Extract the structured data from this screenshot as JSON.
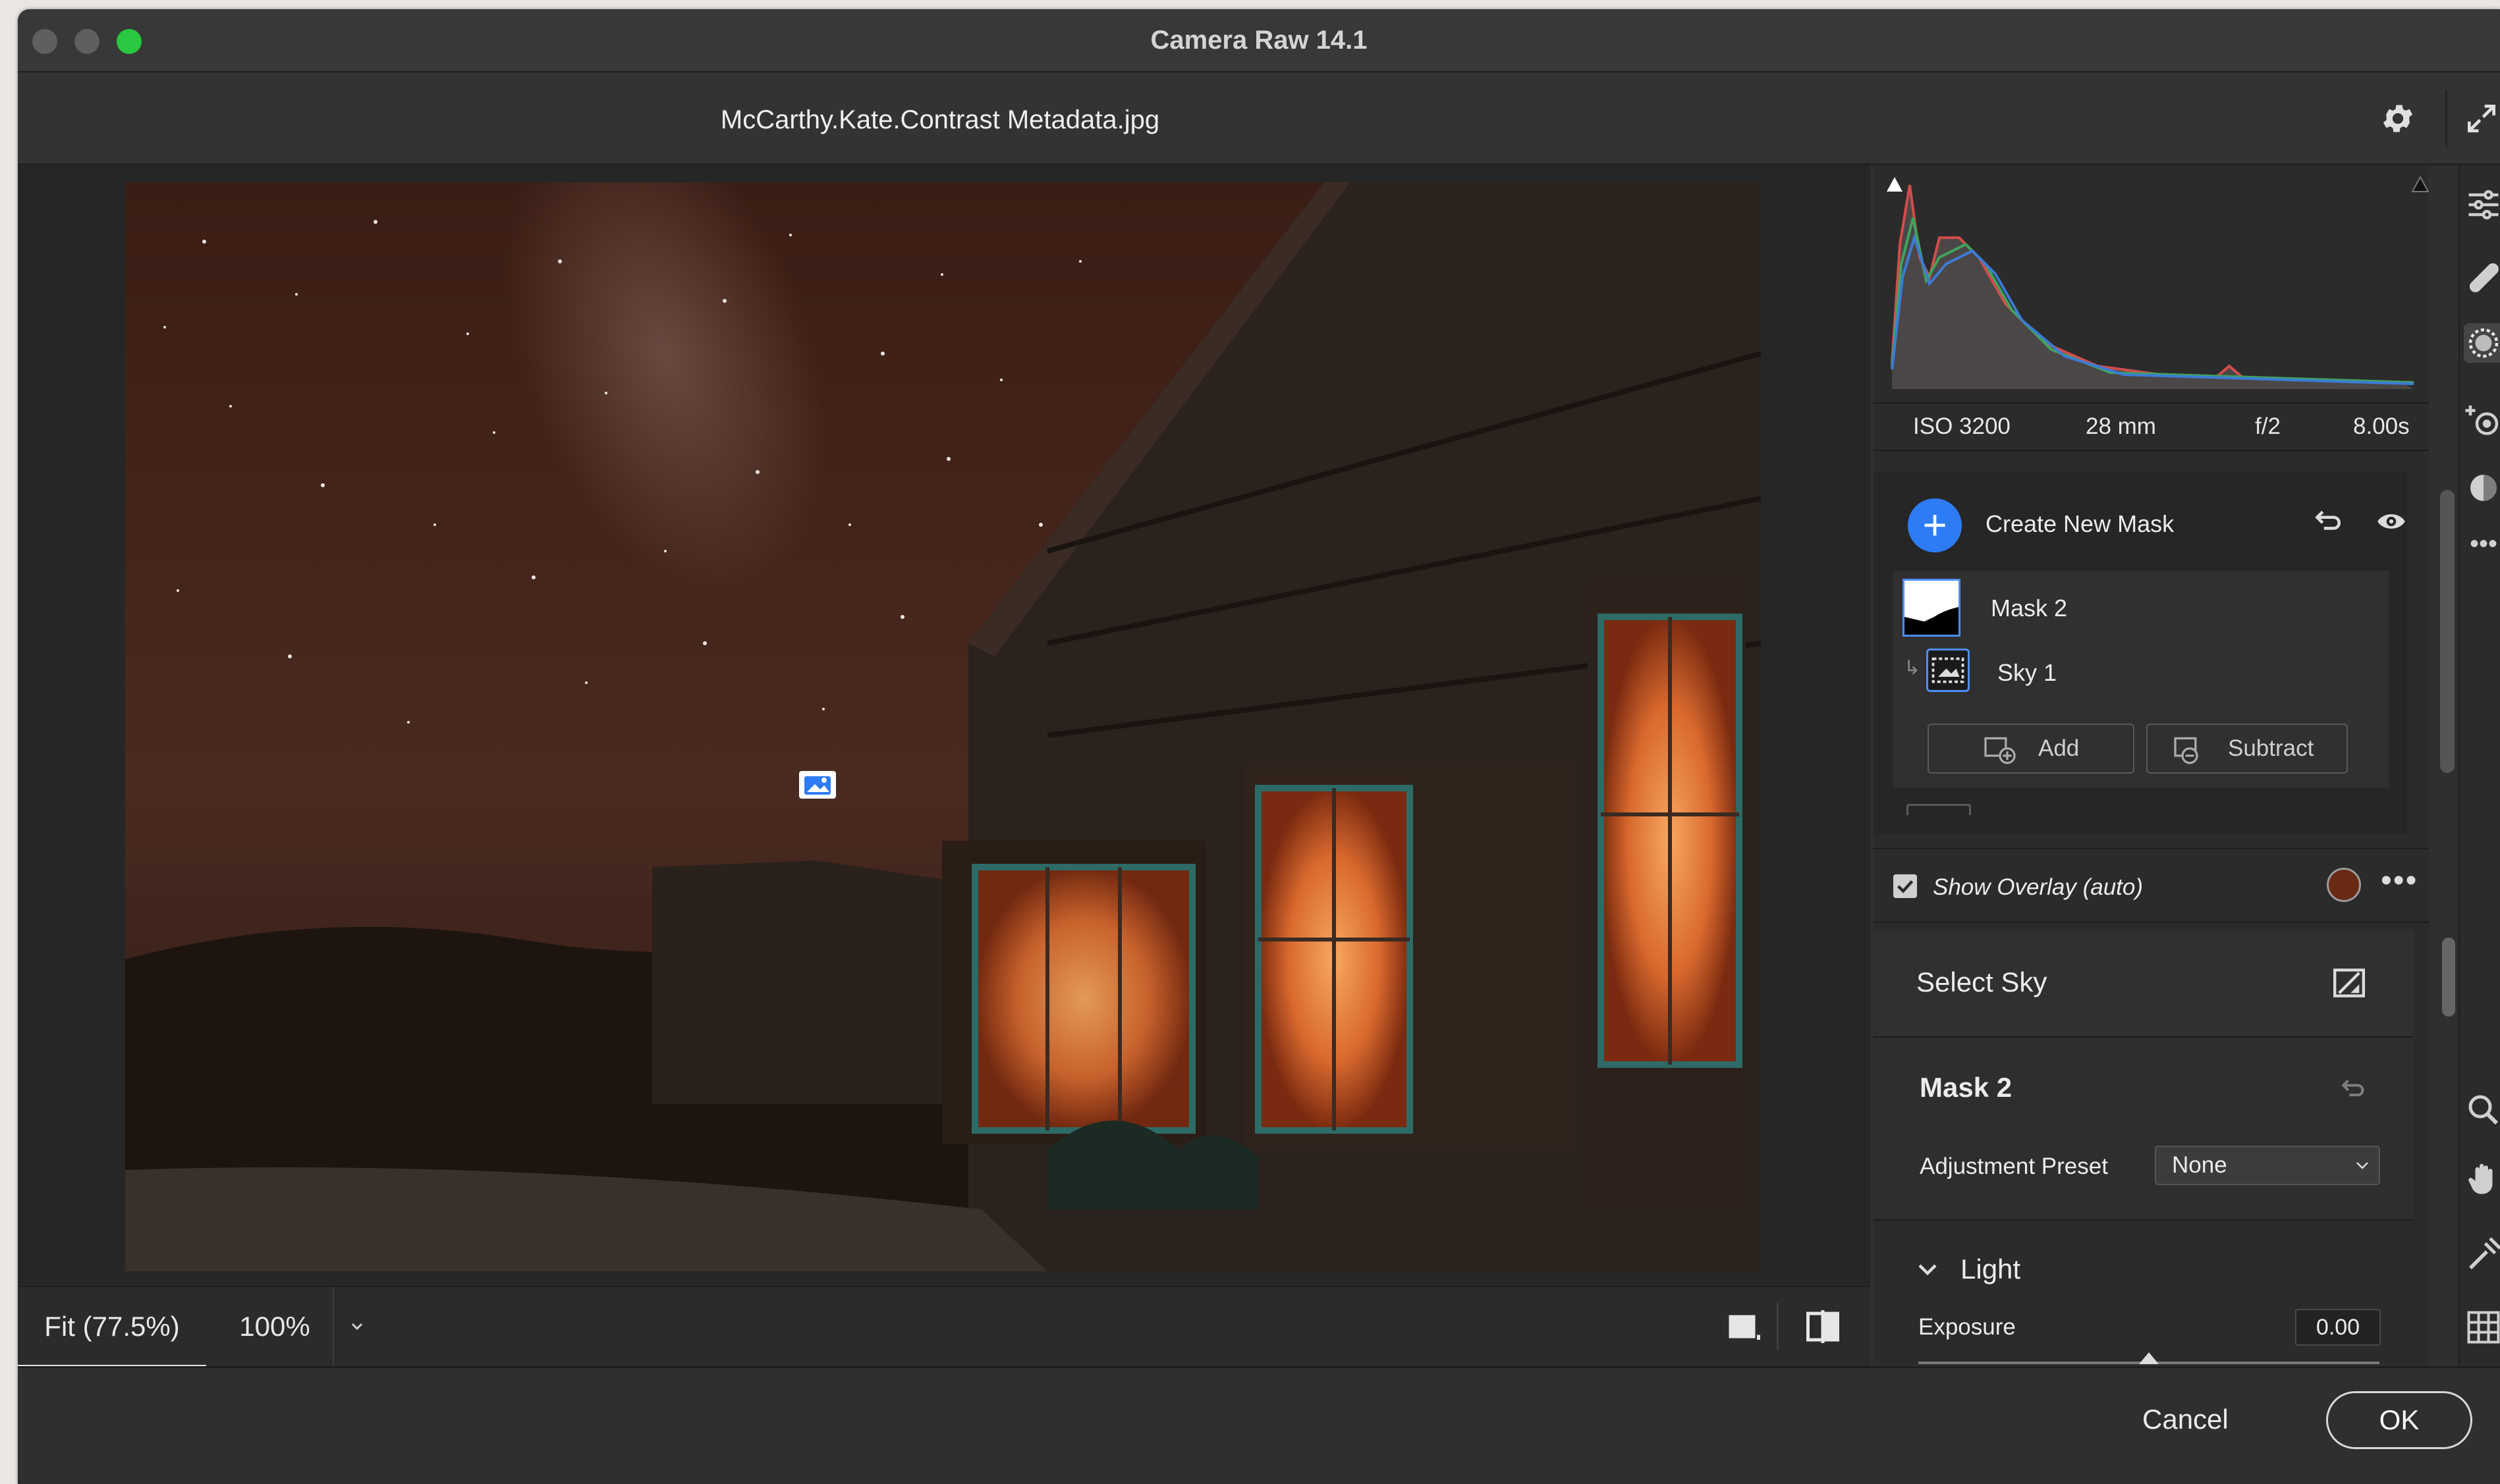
{
  "window": {
    "title": "Camera Raw 14.1"
  },
  "header": {
    "filename": "McCarthy.Kate.Contrast Metadata.jpg"
  },
  "preview": {
    "zoom_fit": "Fit (77.5%)",
    "zoom_100": "100%"
  },
  "exif": {
    "iso": "ISO 3200",
    "focal": "28 mm",
    "aperture": "f/2",
    "shutter": "8.00s"
  },
  "masks": {
    "create_label": "Create New Mask",
    "items": [
      {
        "name": "Mask 2"
      },
      {
        "name": "Sky 1"
      }
    ],
    "add_label": "Add",
    "subtract_label": "Subtract"
  },
  "overlay": {
    "label": "Show Overlay (auto)",
    "checked": true,
    "color": "#6a2a14"
  },
  "select_sky": {
    "label": "Select Sky"
  },
  "mask2": {
    "title": "Mask 2",
    "preset_label": "Adjustment Preset",
    "preset_value": "None"
  },
  "light": {
    "label": "Light",
    "exposure_label": "Exposure",
    "exposure_value": "0.00"
  },
  "footer": {
    "cancel_label": "Cancel",
    "ok_label": "OK"
  },
  "colors": {
    "accent": "#2d7cf6",
    "selection": "#4d8ef8"
  }
}
